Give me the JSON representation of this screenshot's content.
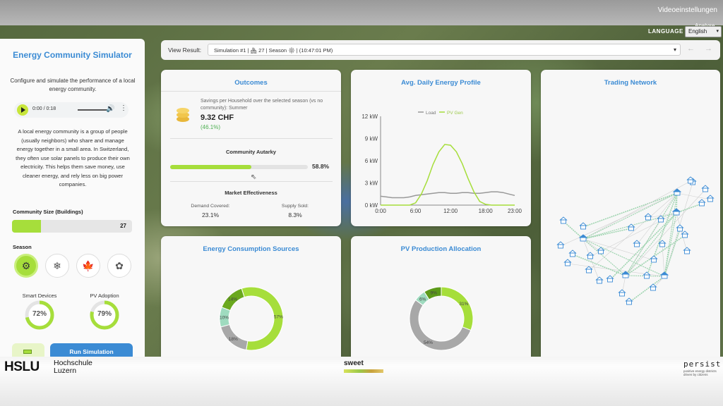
{
  "video": {
    "settings": "Videoeinstellungen",
    "analyse": "Analyse"
  },
  "language": {
    "label": "LANGUAGE",
    "selected": "English"
  },
  "sidebar": {
    "title": "Energy Community Simulator",
    "subtitle": "Configure and simulate the performance of a local energy community.",
    "audio": {
      "time": "0:00 / 0:18"
    },
    "description": "A local energy community is a group of people (usually neighbors) who share and manage energy together in a small area. In Switzerland, they often use solar panels to produce their own electricity. This helps them save money, use cleaner energy, and rely less on big power companies.",
    "community_size": {
      "label": "Community Size (Buildings)",
      "value": "27",
      "fraction": 0.24
    },
    "season": {
      "label": "Season",
      "options": [
        "gear-icon",
        "snowflake-icon",
        "maple-leaf-icon",
        "flower-icon"
      ],
      "active": 0
    },
    "smart_devices": {
      "label": "Smart Devices",
      "value": "72%",
      "percent": 72
    },
    "pv_adoption": {
      "label": "PV Adoption",
      "value": "79%",
      "percent": 79
    },
    "run_label": "Run Simulation"
  },
  "view_result": {
    "label": "View Result:",
    "selected": "Simulation #1 | 🏘 27 | Season ⚙ | (10:47:01 PM)"
  },
  "outcomes": {
    "title": "Outcomes",
    "savings_label": "Savings per Household over the selected season (vs no community): Summer",
    "savings_value": "9.32 CHF",
    "savings_pct": "(46.1%)",
    "autarky_label": "Community Autarky",
    "autarky_value": "58.8%",
    "autarky_fraction": 0.588,
    "market_label": "Market Effectiveness",
    "demand_label": "Demand Covered:",
    "demand_value": "23.1%",
    "supply_label": "Supply Sold:",
    "supply_value": "8.3%"
  },
  "profile": {
    "title": "Avg. Daily Energy Profile"
  },
  "network": {
    "title": "Trading Network"
  },
  "consumption": {
    "title": "Energy Consumption Sources"
  },
  "pv_allocation": {
    "title": "PV Production Allocation"
  },
  "chart_data": [
    {
      "type": "line",
      "title": "Avg. Daily Energy Profile",
      "x": [
        0,
        1,
        2,
        3,
        4,
        5,
        6,
        7,
        8,
        9,
        10,
        11,
        12,
        13,
        14,
        15,
        16,
        17,
        18,
        19,
        20,
        21,
        22,
        23
      ],
      "x_ticks": [
        "0:00",
        "6:00",
        "12:00",
        "18:00",
        "23:00"
      ],
      "y_ticks": [
        "0 kW",
        "3 kW",
        "6 kW",
        "9 kW",
        "12 kW"
      ],
      "ylim": [
        0,
        12
      ],
      "legend_position": "top",
      "series": [
        {
          "name": "Load",
          "color": "#999999",
          "values": [
            1.2,
            1.1,
            1.0,
            1.0,
            1.0,
            1.1,
            1.3,
            1.4,
            1.5,
            1.6,
            1.7,
            1.7,
            1.6,
            1.6,
            1.7,
            1.7,
            1.6,
            1.6,
            1.7,
            1.8,
            1.8,
            1.7,
            1.5,
            1.3
          ]
        },
        {
          "name": "PV Gen",
          "color": "#a6de3b",
          "values": [
            0,
            0,
            0,
            0,
            0,
            0,
            0.3,
            1.5,
            3.3,
            5.5,
            7.2,
            8.2,
            8.1,
            7.2,
            5.6,
            3.6,
            1.8,
            0.5,
            0.1,
            0,
            0,
            0,
            0,
            0
          ]
        }
      ]
    },
    {
      "type": "pie",
      "title": "Energy Consumption Sources",
      "values": [
        57,
        18,
        10,
        14
      ],
      "labels": [
        "57%",
        "18%",
        "10%",
        "14%"
      ],
      "colors": [
        "#a6de3b",
        "#a8a8a8",
        "#9fdbbf",
        "#6aa81e"
      ]
    },
    {
      "type": "pie",
      "title": "PV Production Allocation",
      "values": [
        31,
        54,
        6,
        9
      ],
      "labels": [
        "31%",
        "54%",
        "6%",
        "9%"
      ],
      "colors": [
        "#a6de3b",
        "#a8a8a8",
        "#9fdbbf",
        "#5c9a1a"
      ]
    }
  ],
  "footer": {
    "hslu": "HSLU",
    "hslu_sub1": "Hochschule",
    "hslu_sub2": "Luzern",
    "sweet": "sweet",
    "persist": "persist",
    "persist_sub": "positive energy districts driven by citizens"
  },
  "colors": {
    "accent": "#3b8bd4",
    "green": "#a6de3b"
  }
}
